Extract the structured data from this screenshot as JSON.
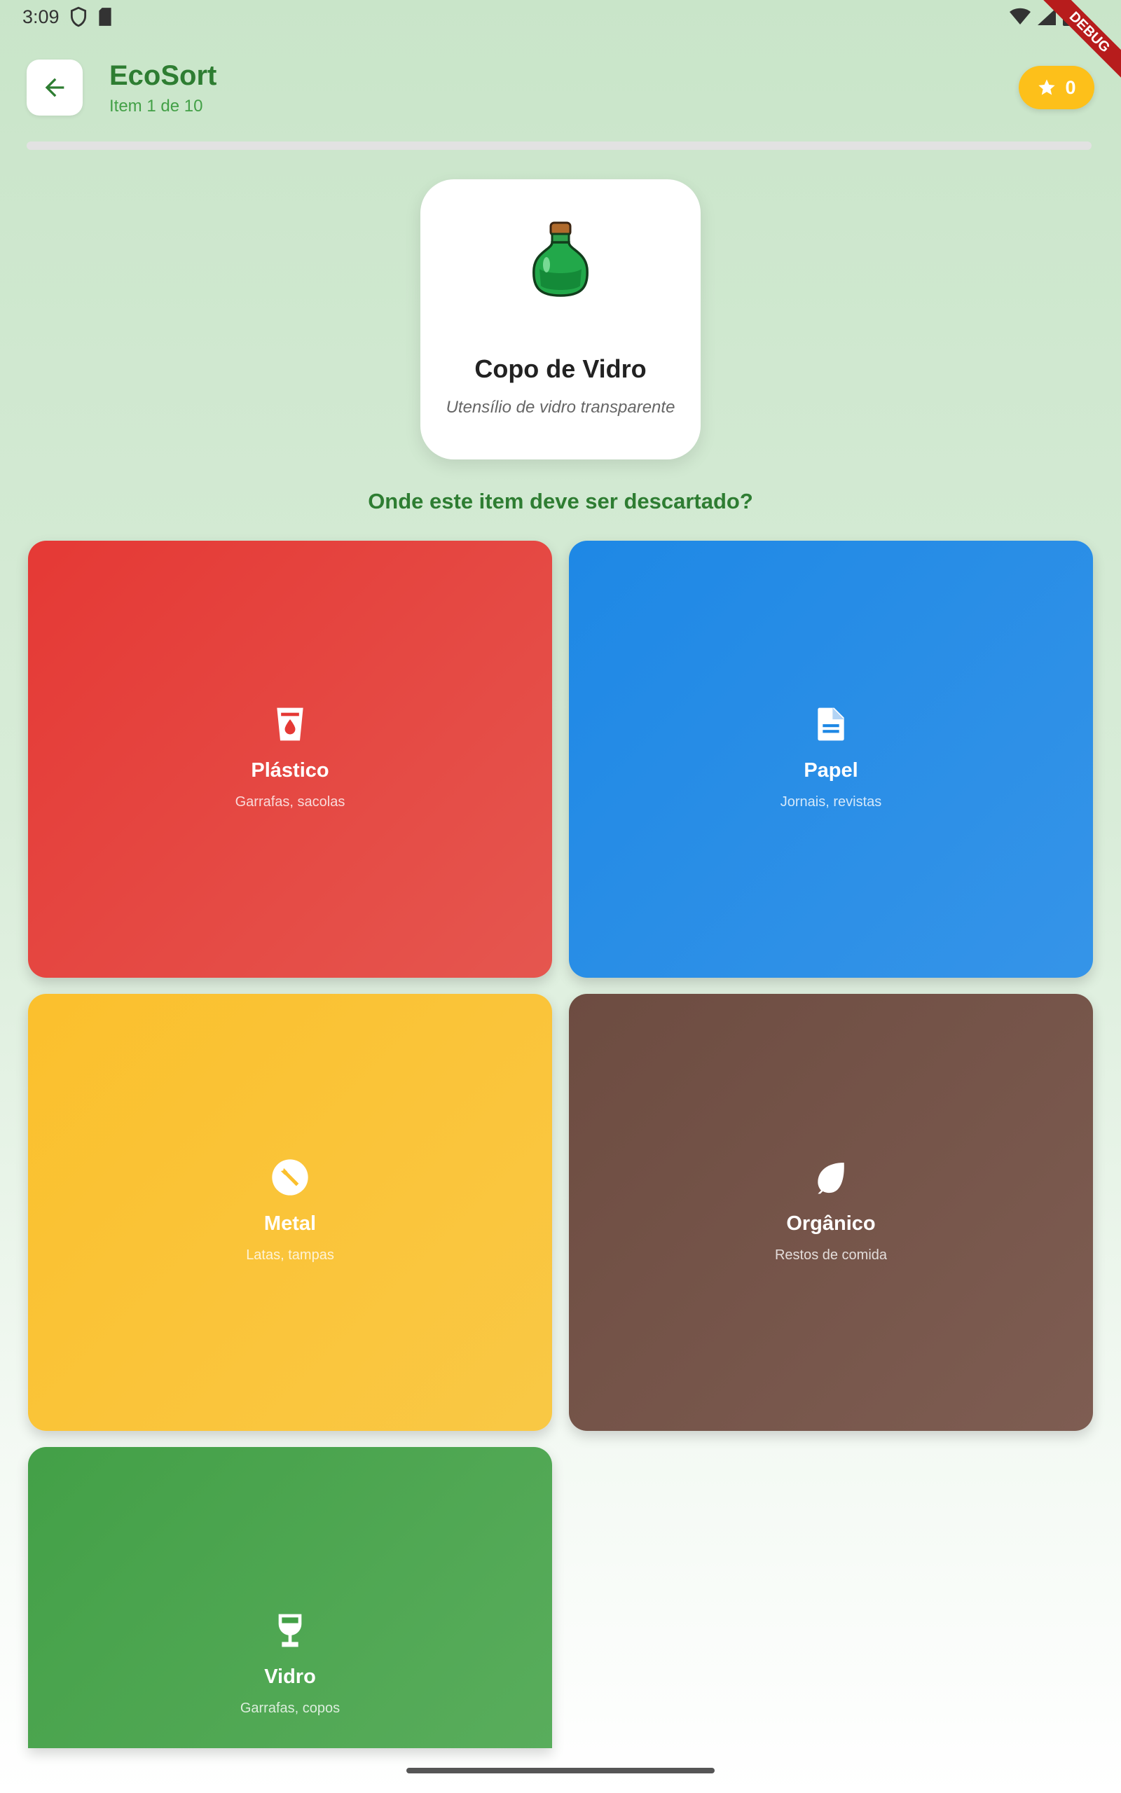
{
  "status_bar": {
    "time": "3:09"
  },
  "debug_ribbon": {
    "label": "DEBUG"
  },
  "header": {
    "title": "EcoSort",
    "subtitle": "Item 1 de 10",
    "score": "0",
    "back_icon": "arrow-back-icon",
    "score_icon": "star-icon"
  },
  "progress": {
    "current": 1,
    "total": 10,
    "fraction": 0.0
  },
  "item": {
    "name": "Copo de Vidro",
    "description": "Utensílio de vidro transparente",
    "icon": "green-bottle-icon"
  },
  "question": "Onde este item deve ser descartado?",
  "bins": [
    {
      "label": "Plástico",
      "subtitle": "Garrafas, sacolas",
      "icon": "cup-drop-icon",
      "color": "#e53935"
    },
    {
      "label": "Papel",
      "subtitle": "Jornais, revistas",
      "icon": "document-icon",
      "color": "#1e88e5"
    },
    {
      "label": "Metal",
      "subtitle": "Latas, tampas",
      "icon": "wrench-icon",
      "color": "#fbc02d"
    },
    {
      "label": "Orgânico",
      "subtitle": "Restos de comida",
      "icon": "leaf-icon",
      "color": "#6d4c41"
    },
    {
      "label": "Vidro",
      "subtitle": "Garrafas, copos",
      "icon": "wine-glass-icon",
      "color": "#43a047"
    }
  ],
  "colors": {
    "accent": "#2e7d32",
    "badge": "#fdc01a"
  }
}
